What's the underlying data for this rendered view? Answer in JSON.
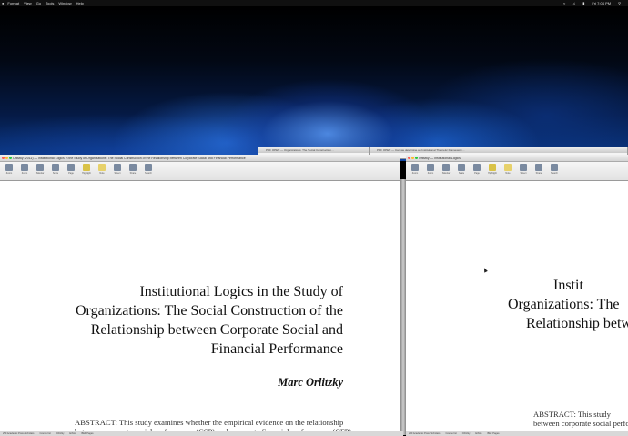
{
  "menubar": {
    "items": [
      "Format",
      "View",
      "Go",
      "Tools",
      "Window",
      "Help"
    ],
    "status_clock": "Fri 7:04 PM"
  },
  "background_windows": {
    "left_title": "PDF OPEN — Organizations: The Social Construction…",
    "right_title": "PDF OPEN — Can we determine an Institutional Theoretic Framework…"
  },
  "left_window": {
    "title": "Orlitzky (2011) — Institutional Logics in the Study of Organizations: The Social Construction of the Relationship between Corporate Social and Financial Performance",
    "toolbar": [
      "Zoom",
      "Zoom",
      "Sidebar",
      "Scale",
      "Page",
      "Highlight",
      "Note",
      "Select",
      "Share",
      "Search"
    ],
    "status": [
      "250 Academic Press Scholars",
      "Course list",
      "Orlitzky",
      "Ethics",
      "BEF Pages"
    ]
  },
  "right_window": {
    "title": "Orlitzky — Institutional Logics",
    "toolbar": [
      "Zoom",
      "Zoom",
      "Sidebar",
      "Scale",
      "Page",
      "Highlight",
      "Note",
      "Select",
      "Share",
      "Search"
    ],
    "status": [
      "250 Academic Press Scholars",
      "Course list",
      "Orlitzky",
      "Ethics",
      "BEF Pages"
    ]
  },
  "paper": {
    "title_lines": [
      "Institutional Logics in the Study of",
      "Organizations: The Social Construction of the",
      "Relationship between Corporate Social and",
      "Financial Performance"
    ],
    "author": "Marc Orlitzky",
    "abstract_lines": [
      "ABSTRACT: This study examines whether the empirical evidence on the relationship",
      "between corporate social performance (CSP) and corporate financial performance (CFP)"
    ]
  },
  "right_paper": {
    "title_lines": [
      "Instit",
      "Organizations: The",
      "Relationship betw"
    ],
    "abstract_lines": [
      "ABSTRACT: This study",
      "between corporate social perfo"
    ]
  },
  "colors": {
    "desktop_glow": "#2f7ae0",
    "window_chrome": "#e2e2e2"
  }
}
